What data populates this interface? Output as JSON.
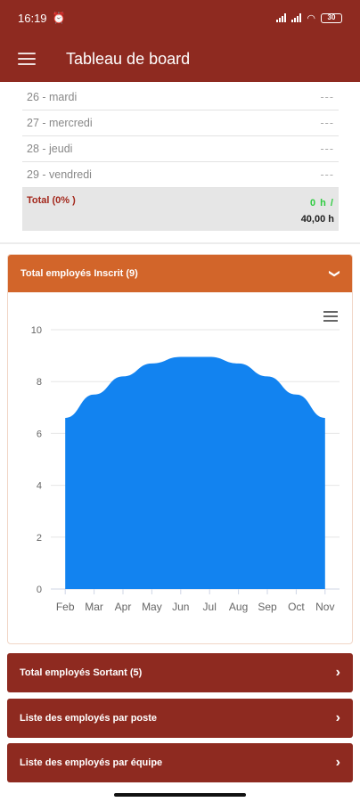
{
  "status_bar": {
    "time": "16:19",
    "alarm_icon": "alarm-clock-icon",
    "battery": "30"
  },
  "app_bar": {
    "title": "Tableau de board"
  },
  "days": [
    {
      "label": "26 - mardi",
      "value": "---"
    },
    {
      "label": "27 - mercredi",
      "value": "---"
    },
    {
      "label": "28 - jeudi",
      "value": "---"
    },
    {
      "label": "29 - vendredi",
      "value": "---"
    }
  ],
  "total": {
    "label": "Total (0% )",
    "hours": "0 h /",
    "target": "40,00 h"
  },
  "employees_card": {
    "title": "Total employés Inscrit (9)"
  },
  "chart_data": {
    "type": "area",
    "categories": [
      "Feb",
      "Mar",
      "Apr",
      "May",
      "Jun",
      "Jul",
      "Aug",
      "Sep",
      "Oct",
      "Nov"
    ],
    "values": [
      6.6,
      7.5,
      8.2,
      8.7,
      8.95,
      8.95,
      8.7,
      8.2,
      7.5,
      6.6
    ],
    "ylim": [
      0,
      10
    ],
    "yticks": [
      "0",
      "2",
      "4",
      "6",
      "8",
      "10"
    ],
    "color": "#1283f0",
    "grid": true
  },
  "accordions": [
    {
      "label": "Total employés Sortant (5)"
    },
    {
      "label": "Liste des employés par poste"
    },
    {
      "label": "Liste des employés par équipe"
    }
  ],
  "colors": {
    "primary": "#8e2a20",
    "accent": "#d2652a",
    "area": "#1283f0"
  }
}
